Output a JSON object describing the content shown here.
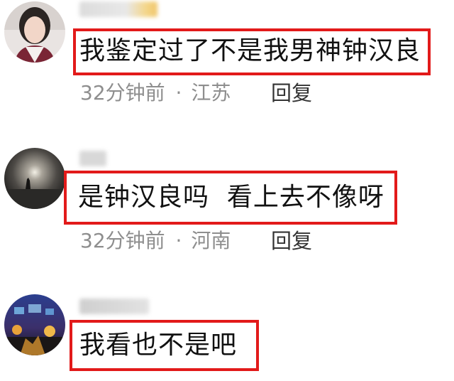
{
  "comments": [
    {
      "text": "我鉴定过了不是我男神钟汉良",
      "time": "32分钟前",
      "location": "江苏",
      "reply_label": "回复",
      "separator": "·"
    },
    {
      "text": "是钟汉良吗  看上去不像呀",
      "time": "32分钟前",
      "location": "河南",
      "reply_label": "回复",
      "separator": "·"
    },
    {
      "text": "我看也不是吧",
      "time": "",
      "location": "",
      "reply_label": "",
      "separator": ""
    }
  ],
  "colors": {
    "highlight_border": "#e21a1a",
    "meta_text": "#8e8e8e",
    "comment_text": "#111111"
  }
}
